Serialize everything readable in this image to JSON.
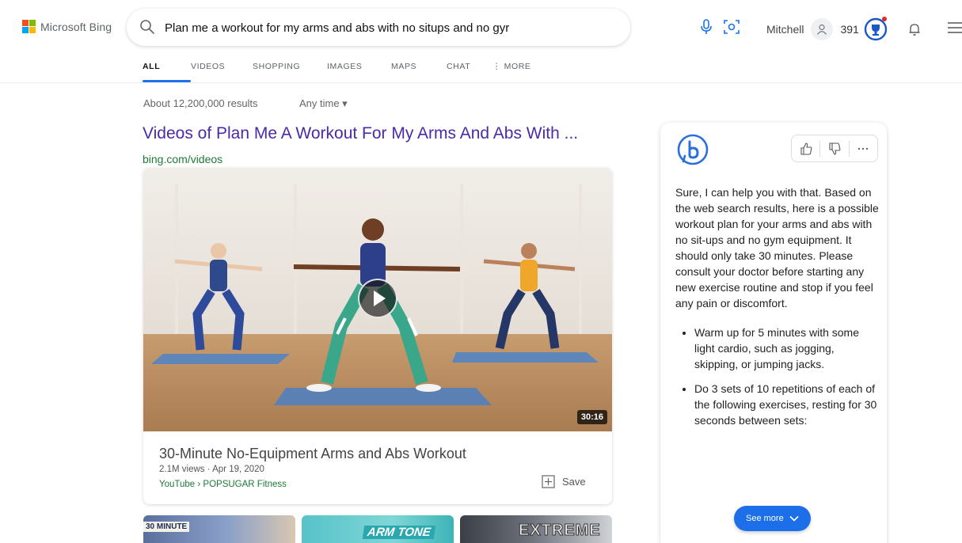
{
  "header": {
    "brand": "Microsoft Bing",
    "search_query": "Plan me a workout for my arms and abs with no situps and no gyr",
    "user_name": "Mitchell",
    "points": "391"
  },
  "tabs": [
    {
      "label": "ALL",
      "active": true
    },
    {
      "label": "VIDEOS",
      "active": false
    },
    {
      "label": "SHOPPING",
      "active": false
    },
    {
      "label": "IMAGES",
      "active": false
    },
    {
      "label": "MAPS",
      "active": false
    },
    {
      "label": "CHAT",
      "active": false
    },
    {
      "label": "⋮ MORE",
      "active": false
    }
  ],
  "results": {
    "count": "About 12,200,000 results",
    "time_filter": "Any time ▾",
    "title": "Videos of Plan Me A Workout For My Arms And Abs With ...",
    "url": "bing.com/videos",
    "video": {
      "duration": "30:16",
      "title": "30-Minute No-Equipment Arms and Abs Workout",
      "meta": "2.1M views · Apr 19, 2020",
      "source": "YouTube › POPSUGAR Fitness",
      "save_label": "Save"
    },
    "thumbs": [
      {
        "label": "30 MINUTE"
      },
      {
        "label": "ARM TONE"
      },
      {
        "label": "EXTREME"
      }
    ]
  },
  "chat": {
    "intro": "Sure, I can help you with that. Based on the web search results, here is a possible workout plan for your arms and abs with no sit-ups and no gym equipment. It should only take 30 minutes. Please consult your doctor before starting any new exercise routine and stop if you feel any pain or discomfort.",
    "bullets": [
      "Warm up for 5 minutes with some light cardio, such as jogging, skipping, or jumping jacks.",
      "Do 3 sets of 10 repetitions of each of the following exercises, resting for 30 seconds between sets:"
    ],
    "see_more": "See more"
  },
  "colors": {
    "accent": "#1a73e8",
    "title_link": "#4b2aa8",
    "url_green": "#1e7a36",
    "see_more_bg": "#1c6fe8"
  }
}
